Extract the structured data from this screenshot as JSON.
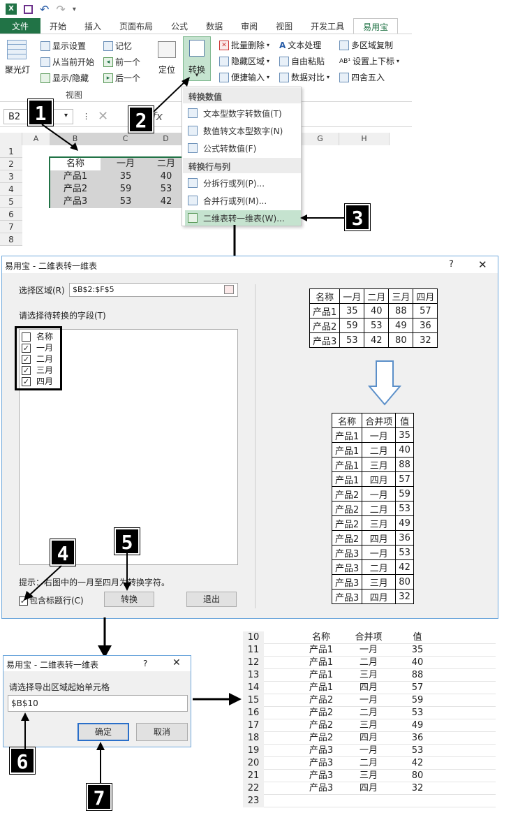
{
  "qat": {
    "undo": "↶",
    "redo": "↷"
  },
  "tabs": [
    "文件",
    "开始",
    "插入",
    "页面布局",
    "公式",
    "数据",
    "审阅",
    "视图",
    "开发工具",
    "易用宝"
  ],
  "ribbon": {
    "spotlight": "聚光灯",
    "view_items": [
      "显示设置",
      "从当前开始",
      "显示/隐藏"
    ],
    "memory_items": [
      "记忆",
      "前一个",
      "后一个"
    ],
    "view_group": "视图",
    "locate": "定位",
    "convert": "转换",
    "col3": [
      "批量删除",
      "隐藏区域",
      "便捷输入"
    ],
    "col4": [
      "文本处理",
      "自由粘贴",
      "数据对比"
    ],
    "col5": [
      "多区域复制",
      "设置上下标",
      "四舍五入"
    ]
  },
  "formula": {
    "namebox": "B2",
    "fx": "fx"
  },
  "sheet": {
    "cols": [
      "A",
      "B",
      "C",
      "D",
      "G",
      "H"
    ],
    "rows": [
      "1",
      "2",
      "3",
      "4",
      "5",
      "6",
      "7",
      "8"
    ],
    "data": [
      [
        "名称",
        "一月",
        "二月"
      ],
      [
        "产品1",
        "35",
        "40"
      ],
      [
        "产品2",
        "59",
        "53"
      ],
      [
        "产品3",
        "53",
        "42"
      ]
    ]
  },
  "menu": {
    "head1": "转换数值",
    "items1": [
      "文本型数字转数值(T)",
      "数值转文本型数字(N)",
      "公式转数值(F)"
    ],
    "head2": "转换行与列",
    "items2": [
      "分拆行或列(P)...",
      "合并行或列(M)...",
      "二维表转一维表(W)..."
    ]
  },
  "callouts": [
    "1",
    "2",
    "3",
    "4",
    "5",
    "6",
    "7"
  ],
  "dialog1": {
    "title": "易用宝 - 二维表转一维表",
    "help": "?",
    "close": "✕",
    "range_label": "选择区域(R)",
    "range_value": "$B$2:$F$5",
    "fields_label": "请选择待转换的字段(T)",
    "fields": [
      {
        "name": "名称",
        "checked": false
      },
      {
        "name": "一月",
        "checked": true
      },
      {
        "name": "二月",
        "checked": true
      },
      {
        "name": "三月",
        "checked": true
      },
      {
        "name": "四月",
        "checked": true
      }
    ],
    "hint": "提示：右图中的一月至四月为转换字符。",
    "include_header": "包含标题行(C)",
    "convert_btn": "转换",
    "exit_btn": "退出",
    "src_table": [
      [
        "名称",
        "一月",
        "二月",
        "三月",
        "四月"
      ],
      [
        "产品1",
        "35",
        "40",
        "88",
        "57"
      ],
      [
        "产品2",
        "59",
        "53",
        "49",
        "36"
      ],
      [
        "产品3",
        "53",
        "42",
        "80",
        "32"
      ]
    ],
    "dst_header": [
      "名称",
      "合并项",
      "值"
    ],
    "dst_rows": [
      [
        "产品1",
        "一月",
        "35"
      ],
      [
        "产品1",
        "二月",
        "40"
      ],
      [
        "产品1",
        "三月",
        "88"
      ],
      [
        "产品1",
        "四月",
        "57"
      ],
      [
        "产品2",
        "一月",
        "59"
      ],
      [
        "产品2",
        "二月",
        "53"
      ],
      [
        "产品2",
        "三月",
        "49"
      ],
      [
        "产品2",
        "四月",
        "36"
      ],
      [
        "产品3",
        "一月",
        "53"
      ],
      [
        "产品3",
        "二月",
        "42"
      ],
      [
        "产品3",
        "三月",
        "80"
      ],
      [
        "产品3",
        "四月",
        "32"
      ]
    ]
  },
  "dialog2": {
    "title": "易用宝 - 二维表转一维表",
    "help": "?",
    "close": "✕",
    "prompt": "请选择导出区域起始单元格",
    "value": "$B$10",
    "ok": "确定",
    "cancel": "取消"
  },
  "result": {
    "header": [
      "名称",
      "合并项",
      "值"
    ],
    "row_numbers": [
      "10",
      "11",
      "12",
      "13",
      "14",
      "15",
      "16",
      "17",
      "18",
      "19",
      "20",
      "21",
      "22",
      "23"
    ]
  },
  "colors": {
    "excel_green": "#217346",
    "highlight": "#c5e3cf",
    "dialog_border": "#6fa8dc"
  }
}
